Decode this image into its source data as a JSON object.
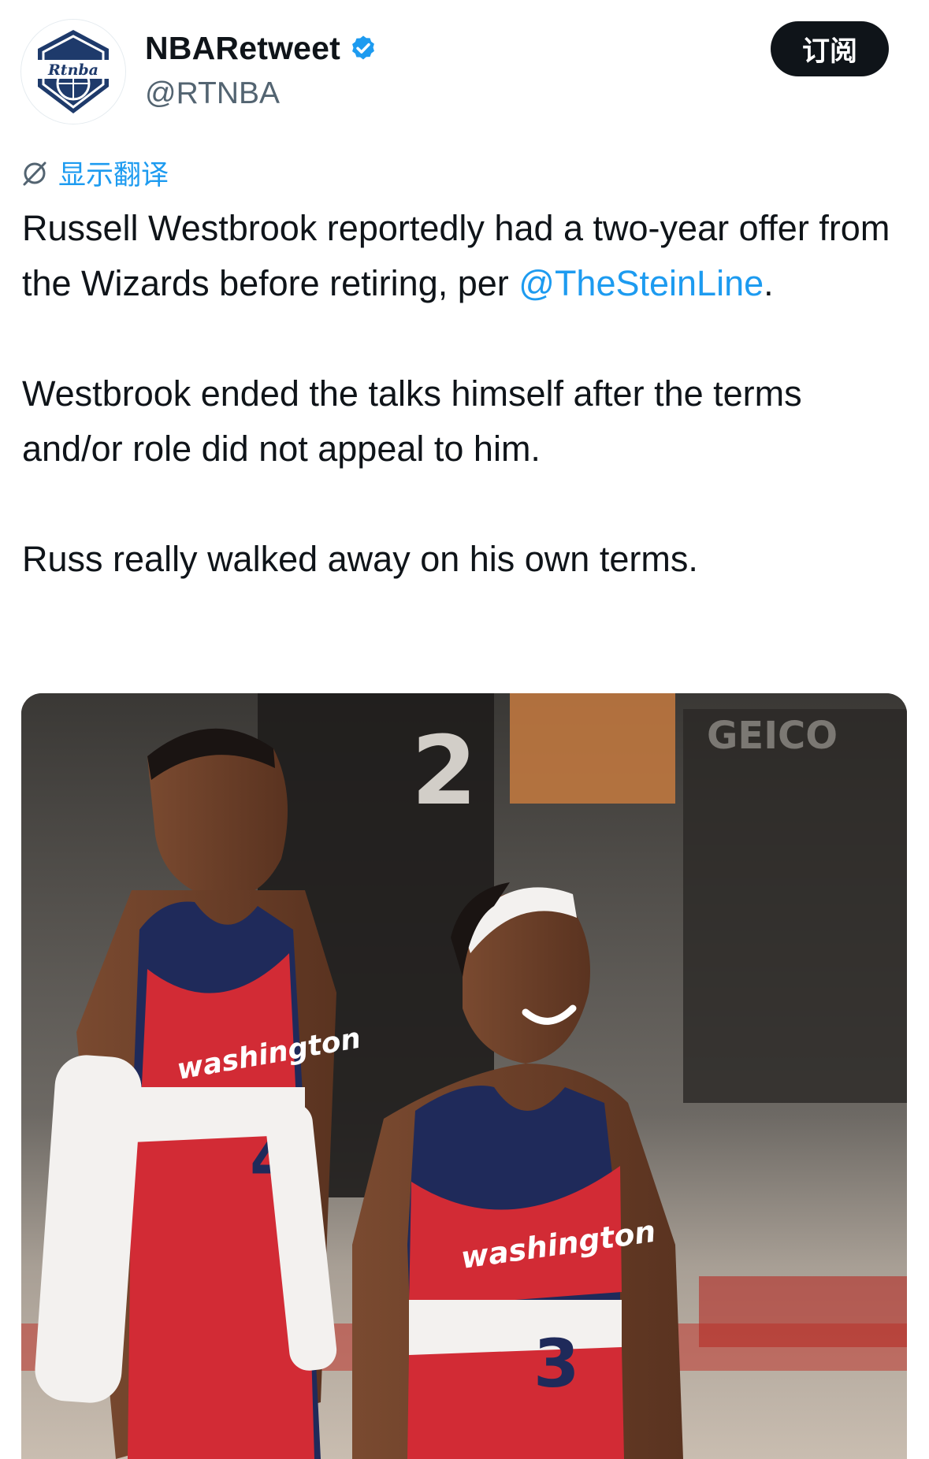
{
  "account": {
    "display_name": "NBARetweet",
    "handle": "@RTNBA",
    "avatar_text": "Rtnba"
  },
  "subscribe_label": "订阅",
  "translate_label": "显示翻译",
  "tweet": {
    "line1": "Russell Westbrook reportedly had a two-year offer from the Wizards before retiring, per ",
    "mention": "@TheSteinLine",
    "line1_end": ".",
    "paragraph2": "Westbrook ended the talks himself after the terms and/or role did not appeal to him.",
    "paragraph3": "Russ really walked away on his own terms."
  },
  "photo": {
    "jersey_text_left": "washington",
    "jersey_text_right": "washington",
    "number_left": "4",
    "number_right": "3",
    "background_number": "2",
    "sponsor": "GEICO"
  },
  "colors": {
    "accent": "#1d9bf0",
    "text": "#0f1419",
    "muted": "#536471",
    "jersey_red": "#d22b35",
    "jersey_navy": "#1f2a5a"
  },
  "icons": {
    "verified": "verified-badge-icon",
    "translate": "translate-icon"
  }
}
